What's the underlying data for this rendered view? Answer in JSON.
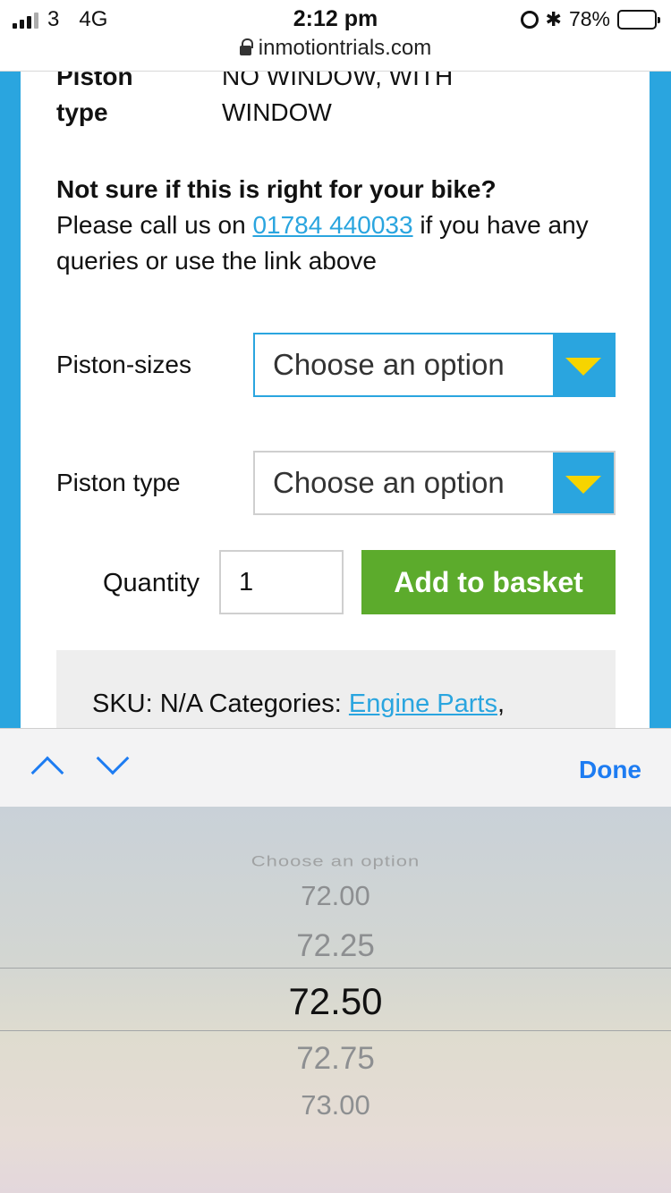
{
  "status_bar": {
    "carrier": "3",
    "network": "4G",
    "time": "2:12 pm",
    "battery": "78%",
    "battery_level": 0.78,
    "url": "inmotiontrials.com"
  },
  "product": {
    "attr_label_top": "Piston",
    "attr_label_bottom": "type",
    "attr_value_top": "NO WINDOW, WITH",
    "attr_value_bottom": "WINDOW",
    "notice_heading": "Not sure if this is right for your bike?",
    "notice_text_1": "Please call us on ",
    "phone": "01784 440033",
    "notice_text_2": " if you have any queries or use the link above"
  },
  "form": {
    "piston_sizes_label": "Piston-sizes",
    "piston_sizes_value": "Choose an option",
    "piston_type_label": "Piston type",
    "piston_type_value": "Choose an option",
    "quantity_label": "Quantity",
    "quantity_value": "1",
    "add_button": "Add to basket"
  },
  "meta": {
    "sku_text": "SKU: N/A Categories: ",
    "category_link": "Engine Parts",
    "comma": ","
  },
  "toolbar": {
    "done": "Done"
  },
  "picker": {
    "options": [
      "Choose an option",
      "72.00",
      "72.25",
      "72.50",
      "72.75",
      "73.00"
    ],
    "selected": "72.50"
  },
  "colors": {
    "brand_blue": "#2aa5df",
    "button_green": "#5cab2c",
    "arrow_yellow": "#f6d400",
    "ios_blue": "#1d7cf2"
  }
}
